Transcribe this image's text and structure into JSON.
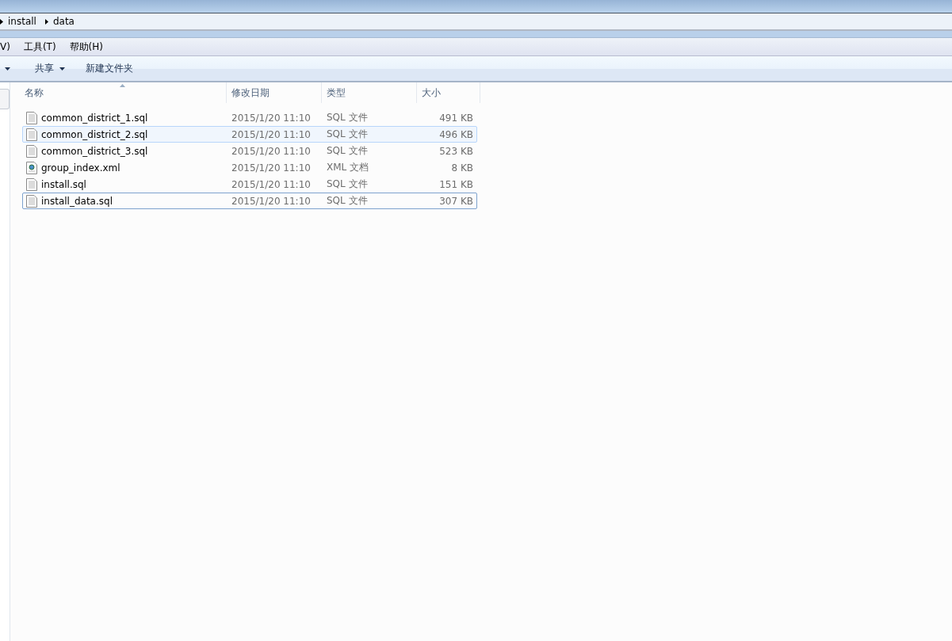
{
  "breadcrumb": [
    "install",
    "data"
  ],
  "menu": [
    "V)",
    "工具(T)",
    "帮助(H)"
  ],
  "toolbar": [
    {
      "label": "共享",
      "dropdown": true
    },
    {
      "label": "新建文件夹",
      "dropdown": false
    }
  ],
  "columns": [
    {
      "label": "名称",
      "sorted": true
    },
    {
      "label": "修改日期",
      "sorted": false
    },
    {
      "label": "类型",
      "sorted": false
    },
    {
      "label": "大小",
      "sorted": false
    }
  ],
  "files": [
    {
      "name": "common_district_1.sql",
      "date": "2015/1/20 11:10",
      "type": "SQL 文件",
      "size": "491 KB",
      "kind": "sql",
      "hover": false,
      "focused": false
    },
    {
      "name": "common_district_2.sql",
      "date": "2015/1/20 11:10",
      "type": "SQL 文件",
      "size": "496 KB",
      "kind": "sql",
      "hover": true,
      "focused": false
    },
    {
      "name": "common_district_3.sql",
      "date": "2015/1/20 11:10",
      "type": "SQL 文件",
      "size": "523 KB",
      "kind": "sql",
      "hover": false,
      "focused": false
    },
    {
      "name": "group_index.xml",
      "date": "2015/1/20 11:10",
      "type": "XML 文档",
      "size": "8 KB",
      "kind": "xml",
      "hover": false,
      "focused": false
    },
    {
      "name": "install.sql",
      "date": "2015/1/20 11:10",
      "type": "SQL 文件",
      "size": "151 KB",
      "kind": "sql",
      "hover": false,
      "focused": false
    },
    {
      "name": "install_data.sql",
      "date": "2015/1/20 11:10",
      "type": "SQL 文件",
      "size": "307 KB",
      "kind": "sql",
      "hover": false,
      "focused": true
    }
  ]
}
